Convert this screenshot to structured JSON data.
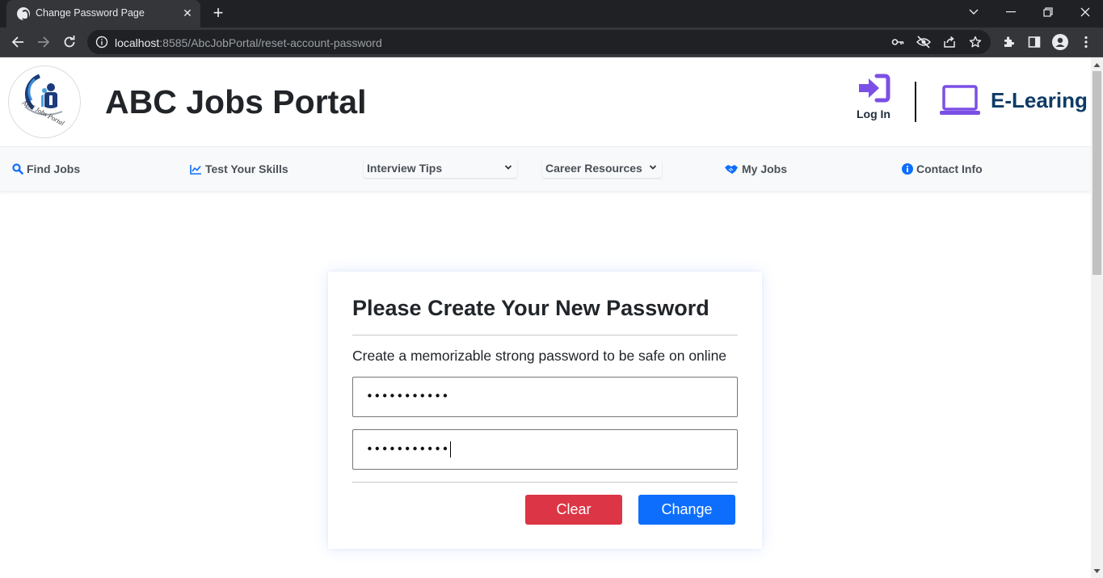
{
  "browser": {
    "tab_title": "Change Password Page",
    "url_host": "localhost",
    "url_rest": ":8585/AbcJobPortal/reset-account-password"
  },
  "header": {
    "title": "ABC Jobs Portal",
    "logo_text": "ABC Jobs Portal",
    "login_label": "Log In",
    "elearning_label": "E-Learing",
    "accent_color": "#7b4fe6"
  },
  "nav": {
    "find_jobs": "Find Jobs",
    "test_skills": "Test Your Skills",
    "interview_tips": "Interview Tips",
    "career_resources": "Career Resources",
    "my_jobs": "My Jobs",
    "contact_info": "Contact Info"
  },
  "form": {
    "title": "Please Create Your New Password",
    "subtitle": "Create a memorizable strong password to be safe on online",
    "password_value": "•••••••••••",
    "confirm_value": "•••••••••••",
    "clear_label": "Clear",
    "change_label": "Change"
  }
}
